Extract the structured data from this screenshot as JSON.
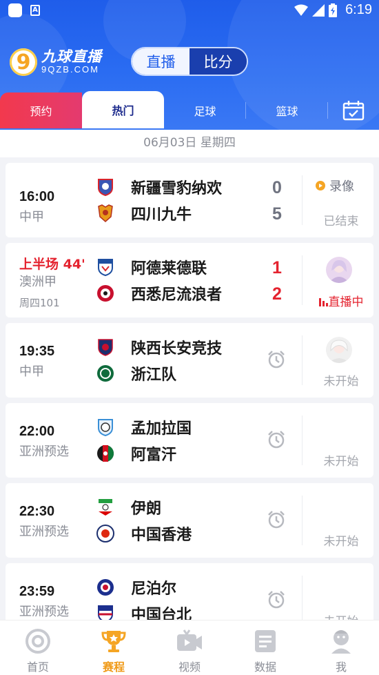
{
  "status_bar": {
    "time": "6:19"
  },
  "app": {
    "logo_badge": "9",
    "logo_cn": "九球直播",
    "logo_en": "9QZB.COM",
    "segment": [
      "直播",
      "比分"
    ]
  },
  "tabs": [
    {
      "label": "预约"
    },
    {
      "label": "热门"
    },
    {
      "label": "足球"
    },
    {
      "label": "篮球"
    }
  ],
  "date_label": "06月03日 星期四",
  "matches": [
    {
      "time": "16:00",
      "league": "中甲",
      "home": "新疆雪豹纳欢",
      "away": "四川九牛",
      "home_score": "0",
      "away_score": "5",
      "replay": "录像",
      "status": "已结束"
    },
    {
      "live_time": "上半场 44'",
      "league": "澳洲甲",
      "sub": "周四101",
      "home": "阿德莱德联",
      "away": "西悉尼流浪者",
      "home_score": "1",
      "away_score": "2",
      "status": "直播中"
    },
    {
      "time": "19:35",
      "league": "中甲",
      "home": "陕西长安竞技",
      "away": "浙江队",
      "status": "未开始"
    },
    {
      "time": "22:00",
      "league": "亚洲预选",
      "home": "孟加拉国",
      "away": "阿富汗",
      "status": "未开始"
    },
    {
      "time": "22:30",
      "league": "亚洲预选",
      "home": "伊朗",
      "away": "中国香港",
      "status": "未开始"
    },
    {
      "time": "23:59",
      "league": "亚洲预选",
      "home": "尼泊尔",
      "away": "中国台北",
      "status": "未开始"
    }
  ],
  "bottom_nav": [
    {
      "label": "首页",
      "icon": "home-icon"
    },
    {
      "label": "赛程",
      "icon": "trophy-icon"
    },
    {
      "label": "视频",
      "icon": "video-icon"
    },
    {
      "label": "数据",
      "icon": "data-icon"
    },
    {
      "label": "我",
      "icon": "profile-icon"
    }
  ],
  "colors": {
    "brand_blue": "#1f5dea",
    "accent_red": "#e4232f",
    "accent_orange": "#f09a18"
  }
}
